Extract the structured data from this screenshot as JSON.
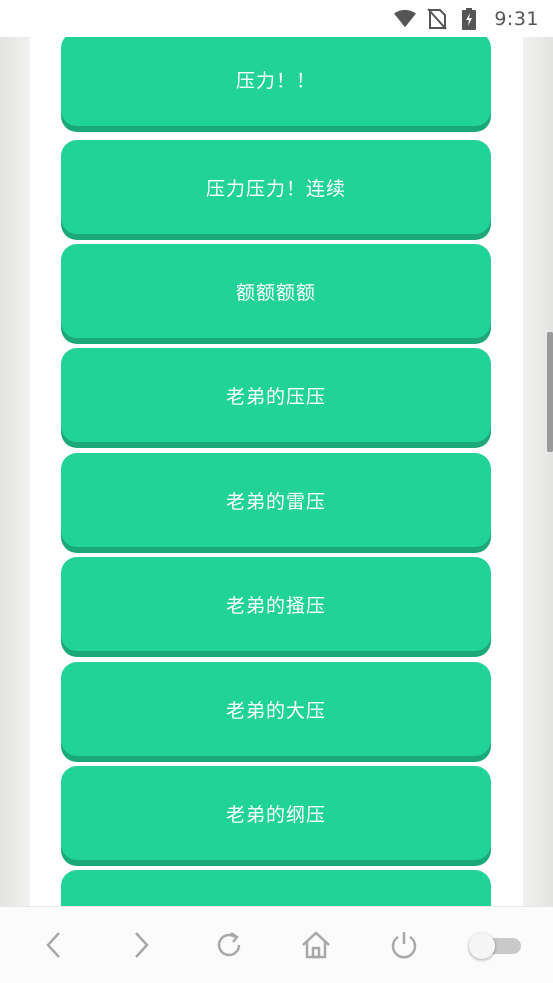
{
  "status_bar": {
    "time": "9:31",
    "icons": [
      "wifi-icon",
      "no-sim-icon",
      "battery-charging-icon"
    ]
  },
  "buttons": [
    {
      "label": "压力！！"
    },
    {
      "label": "压力压力！连续"
    },
    {
      "label": "额额额额"
    },
    {
      "label": "老弟的压压"
    },
    {
      "label": "老弟的雷压"
    },
    {
      "label": "老弟的搔压"
    },
    {
      "label": "老弟的大压"
    },
    {
      "label": "老弟的纲压"
    },
    {
      "label": ""
    }
  ],
  "nav_bar": {
    "icons": [
      "back-icon",
      "forward-icon",
      "refresh-icon",
      "home-icon",
      "power-icon",
      "toggle-switch"
    ]
  },
  "colors": {
    "button": "#21d396",
    "button_shadow": "#1aa87a",
    "background": "#ebecea"
  }
}
